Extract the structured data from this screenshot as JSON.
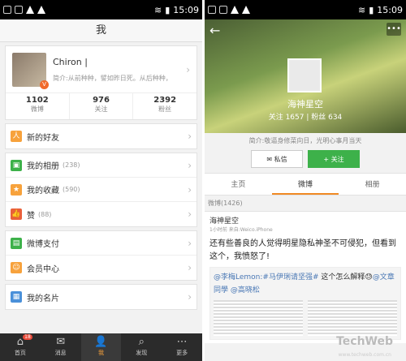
{
  "status_left": {
    "time": "15:09"
  },
  "status_right": {
    "time": "15:09"
  },
  "me": {
    "title": "我",
    "profile": {
      "name": "Chiron |",
      "bio": "简介:从前种种，譬如昨日死。从后种种，"
    },
    "stats": [
      {
        "num": "1102",
        "label": "微博"
      },
      {
        "num": "976",
        "label": "关注"
      },
      {
        "num": "2392",
        "label": "粉丝"
      }
    ],
    "menu": {
      "new_friends": "新的好友",
      "album": "我的相册",
      "album_count": "(238)",
      "favorites": "我的收藏",
      "favorites_count": "(590)",
      "likes": "赞",
      "likes_count": "(88)",
      "pay": "微博支付",
      "vip": "会员中心",
      "card": "我的名片"
    },
    "tabs": [
      {
        "label": "首页",
        "badge": "18"
      },
      {
        "label": "消息"
      },
      {
        "label": "我"
      },
      {
        "label": "发现"
      },
      {
        "label": "更多"
      }
    ]
  },
  "other": {
    "name": "海神星空",
    "follow_line": "关注 1657 | 粉丝 634",
    "bio": "简介:敬逼身修菜向日，光明心事月当天",
    "btn_msg": "私信",
    "btn_follow": "+ 关注",
    "tabs": [
      "主页",
      "微博",
      "相册"
    ],
    "weibo_count": "微博(1426)",
    "post": {
      "author": "海神星空",
      "meta": "1小时前   来自:Weico.iPhone",
      "text": "还有些善良的人觉得明星隐私神圣不可侵犯，但看到这个，我愤怒了!",
      "repost_a": "@李梅Lemon:",
      "repost_b": "#马伊琍请坚强#",
      "repost_c": " 这个怎么解释",
      "repost_d": "@文章同學",
      "repost_e": "@高晓松"
    },
    "watermark": "TechWeb",
    "watermark_url": "www.techweb.com.cn"
  }
}
